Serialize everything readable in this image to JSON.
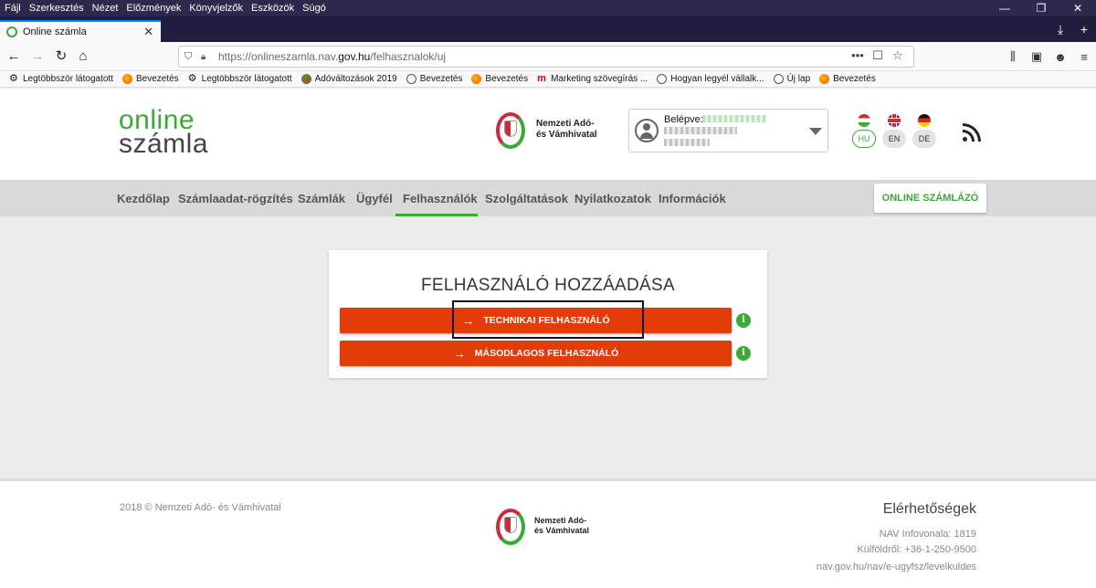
{
  "menubar": {
    "items": [
      "Fájl",
      "Szerkesztés",
      "Nézet",
      "Előzmények",
      "Könyvjelzők",
      "Eszközök",
      "Súgó"
    ],
    "window_controls": [
      "—",
      "❐",
      "✕"
    ]
  },
  "tab": {
    "title": "Online számla",
    "close": "✕"
  },
  "tabstrip_right": [
    "⤓",
    "+"
  ],
  "navbar": {
    "back": "←",
    "forward": "→",
    "reload": "↻",
    "home": "⌂",
    "url_prefix": "https://onlineszamla.nav.",
    "url_domain": "gov.hu",
    "url_path": "/felhasznalok/uj",
    "page_actions": [
      "•••",
      "☐",
      "☆"
    ],
    "right_icons": [
      "⫼",
      "▣",
      "☻",
      "≡"
    ]
  },
  "bookmarks": [
    {
      "icon": "gear",
      "label": "Legtöbbször látogatott"
    },
    {
      "icon": "ff",
      "label": "Bevezetés"
    },
    {
      "icon": "gear",
      "label": "Legtöbbször látogatott"
    },
    {
      "icon": "ado",
      "label": "Adóváltozások 2019"
    },
    {
      "icon": "globe",
      "label": "Bevezetés"
    },
    {
      "icon": "ff",
      "label": "Bevezetés"
    },
    {
      "icon": "m",
      "label": "Marketing szövegírás ..."
    },
    {
      "icon": "globe",
      "label": "Hogyan legyél vállalk..."
    },
    {
      "icon": "globe",
      "label": "Új lap"
    },
    {
      "icon": "ff",
      "label": "Bevezetés"
    }
  ],
  "header": {
    "logo_line1": "online",
    "logo_line2": "számla",
    "nav_name_line1": "Nemzeti Adó-",
    "nav_name_line2": "és Vámhivatal",
    "login_label": "Belépve:",
    "languages": [
      {
        "code": "HU",
        "active": true
      },
      {
        "code": "EN",
        "active": false
      },
      {
        "code": "DE",
        "active": false
      }
    ]
  },
  "mainnav": {
    "items": [
      "Kezdőlap",
      "Számlaadat-rögzítés",
      "Számlák",
      "Ügyfél",
      "Felhasználók",
      "Szolgáltatások",
      "Nyilatkozatok",
      "Információk"
    ],
    "active": "Felhasználók",
    "cta": "ONLINE SZÁMLÁZÓ"
  },
  "card": {
    "title": "FELHASZNÁLÓ HOZZÁADÁSA",
    "buttons": [
      {
        "label": "TECHNIKAI FELHASZNÁLÓ"
      },
      {
        "label": "MÁSODLAGOS FELHASZNÁLÓ"
      }
    ],
    "arrow": "→",
    "info_glyph": "i"
  },
  "footer": {
    "copyright": "2018 © Nemzeti Adó- és Vámhivatal",
    "nav_name_line1": "Nemzeti Adó-",
    "nav_name_line2": "és Vámhivatal",
    "contact_title": "Elérhetőségek",
    "contact_lines": [
      "NAV Infovonala: 1819",
      "Külföldről: +36-1-250-9500",
      "nav.gov.hu/nav/e-ugyfsz/levelkuldes"
    ]
  },
  "colors": {
    "brand_green": "#3aaa35",
    "action_orange": "#e23c08",
    "chrome_dark": "#2b2a4d"
  }
}
